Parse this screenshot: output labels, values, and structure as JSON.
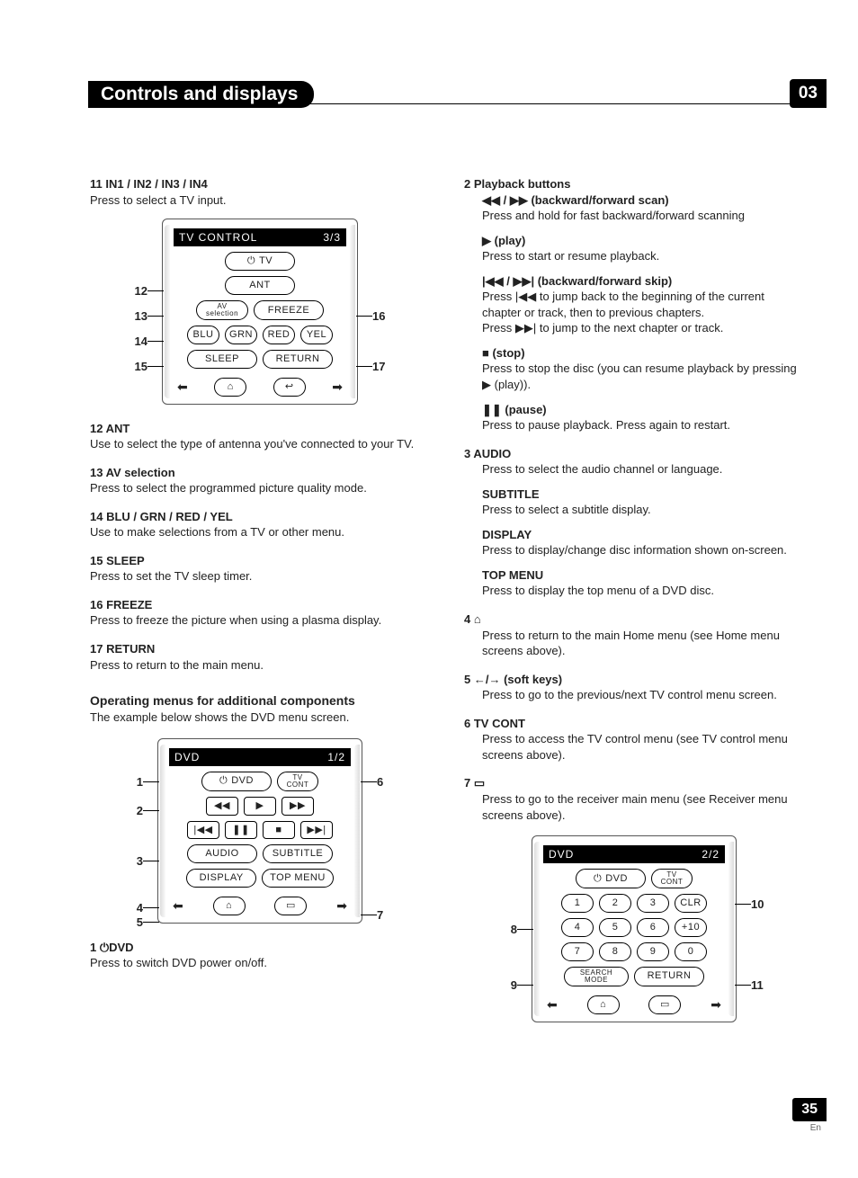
{
  "header": {
    "title": "Controls and displays",
    "chapter": "03"
  },
  "page": {
    "number": "35",
    "lang": "En"
  },
  "col1": {
    "i11": {
      "h": "11  IN1 / IN2 / IN3 / IN4",
      "b": "Press to select a TV input."
    },
    "i12": {
      "h": "12  ANT",
      "b": "Use to select the type of antenna you've connected to your TV."
    },
    "i13": {
      "h": "13  AV selection",
      "b": "Press to select the programmed picture quality mode."
    },
    "i14": {
      "h": "14  BLU / GRN / RED / YEL",
      "b": "Use to make selections from a TV or other menu."
    },
    "i15": {
      "h": "15  SLEEP",
      "b": "Press to set the TV sleep timer."
    },
    "i16": {
      "h": "16  FREEZE",
      "b": "Press to freeze the picture when using a plasma display."
    },
    "i17": {
      "h": "17  RETURN",
      "b": "Press to return to the main menu."
    },
    "sect": {
      "h": "Operating menus for additional components",
      "b": "The example below shows the DVD menu screen."
    },
    "i1d": {
      "h": "1   ⏻DVD",
      "b": "Press to switch DVD power on/off."
    }
  },
  "col2": {
    "i2": {
      "h": "2   Playback buttons",
      "a": {
        "h": "◀◀ / ▶▶ (backward/forward scan)",
        "b": "Press and hold for fast backward/forward scanning"
      },
      "b": {
        "h": "▶ (play)",
        "b": "Press to start or resume playback."
      },
      "c": {
        "h": "|◀◀ / ▶▶| (backward/forward skip)",
        "b1": "Press |◀◀ to jump back to the beginning of the current chapter or track, then to previous chapters.",
        "b2": "Press ▶▶| to jump to the next chapter or track."
      },
      "d": {
        "h": "■ (stop)",
        "b": "Press to stop the disc (you can resume playback by pressing ▶ (play))."
      },
      "e": {
        "h": "❚❚ (pause)",
        "b": "Press to pause playback. Press again to restart."
      }
    },
    "i3": {
      "h": "3   AUDIO",
      "b": "Press to select the audio channel or language.",
      "sub1": {
        "h": "SUBTITLE",
        "b": "Press to select a subtitle display."
      },
      "sub2": {
        "h": "DISPLAY",
        "b": "Press to display/change disc information shown on-screen."
      },
      "sub3": {
        "h": "TOP MENU",
        "b": "Press to display the top menu of a DVD disc."
      }
    },
    "i4": {
      "h": "4   ⌂",
      "b": "Press to return to the main Home menu (see Home menu screens above)."
    },
    "i5": {
      "h": "5   ←/→ (soft keys)",
      "b": "Press to go to the previous/next TV control menu screen."
    },
    "i6": {
      "h": "6   TV CONT",
      "b": "Press to access the TV control menu (see TV control menu screens above)."
    },
    "i7": {
      "h": "7   ▭",
      "b": "Press to go to the receiver main menu (see Receiver menu screens above)."
    }
  },
  "remote1": {
    "title_l": "TV  CONTROL",
    "title_r": "3/3",
    "tv": "TV",
    "ant": "ANT",
    "av": "AV\nselection",
    "freeze": "FREEZE",
    "blu": "BLU",
    "grn": "GRN",
    "red": "RED",
    "yel": "YEL",
    "sleep": "SLEEP",
    "return": "RETURN",
    "c12": "12",
    "c13": "13",
    "c14": "14",
    "c15": "15",
    "c16": "16",
    "c17": "17"
  },
  "remote2": {
    "title_l": "DVD",
    "title_r": "1/2",
    "dvd": "DVD",
    "tvcont": "TV\nCONT",
    "audio": "AUDIO",
    "subtitle": "SUBTITLE",
    "display": "DISPLAY",
    "topmenu": "TOP MENU",
    "c1": "1",
    "c2": "2",
    "c3": "3",
    "c4": "4",
    "c5": "5",
    "c6": "6",
    "c7": "7"
  },
  "remote3": {
    "title_l": "DVD",
    "title_r": "2/2",
    "dvd": "DVD",
    "tvcont": "TV\nCONT",
    "n1": "1",
    "n2": "2",
    "n3": "3",
    "n4": "4",
    "n5": "5",
    "n6": "6",
    "n7": "7",
    "n8": "8",
    "n9": "9",
    "n0": "0",
    "clr": "CLR",
    "p10": "+10",
    "search": "SEARCH\nMODE",
    "return": "RETURN",
    "c8": "8",
    "c9": "9",
    "c10": "10",
    "c11": "11"
  }
}
